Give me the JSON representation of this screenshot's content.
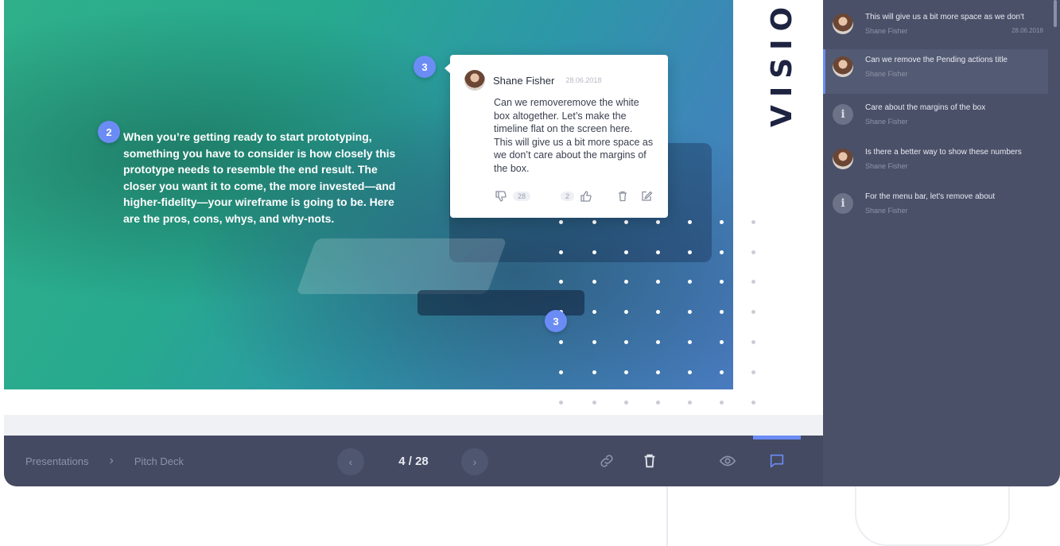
{
  "slide": {
    "title_vertical": "VISION",
    "body_text": "When you’re getting ready to start prototyping, something you have to consider is how closely this prototype needs to resemble the end result. The closer you want it to come, the more invested—and higher-fidelity—your wireframe is going to be. Here are the pros, cons, whys, and why-nots.",
    "markers": [
      "2",
      "3",
      "3"
    ]
  },
  "comment_card": {
    "author": "Shane Fisher",
    "date": "28.06.2018",
    "text": "Can we removeremove the white box altogether. Let’s make the timeline flat on the screen here. This will give us a bit more space as we don’t care about the margins of the box.",
    "dislike_count": "28",
    "like_count": "2"
  },
  "comments_panel": {
    "items": [
      {
        "text": "This will give us a bit more space as we don't",
        "author": "Shane Fisher",
        "date": "28.06.2018",
        "avatar": "photo"
      },
      {
        "text": "Can we remove the Pending actions title",
        "author": "Shane Fisher",
        "date": "",
        "avatar": "photo"
      },
      {
        "text": "Care about the margins of the box",
        "author": "Shane Fisher",
        "date": "",
        "avatar": "info-icon"
      },
      {
        "text": "Is there a better way to show these numbers",
        "author": "Shane Fisher",
        "date": "",
        "avatar": "photo"
      },
      {
        "text": "For the menu bar, let's remove about",
        "author": "Shane Fisher",
        "date": "",
        "avatar": "info-icon"
      }
    ]
  },
  "toolbar": {
    "breadcrumb": [
      "Presentations",
      "Pitch Deck"
    ],
    "page_indicator": "4 / 28",
    "icons": [
      "link-icon",
      "trash-icon",
      "eye-icon",
      "comment-icon"
    ]
  },
  "colors": {
    "accent": "#6b8cf5",
    "toolbar_bg": "#444a61",
    "panel_bg": "#4a5068"
  }
}
